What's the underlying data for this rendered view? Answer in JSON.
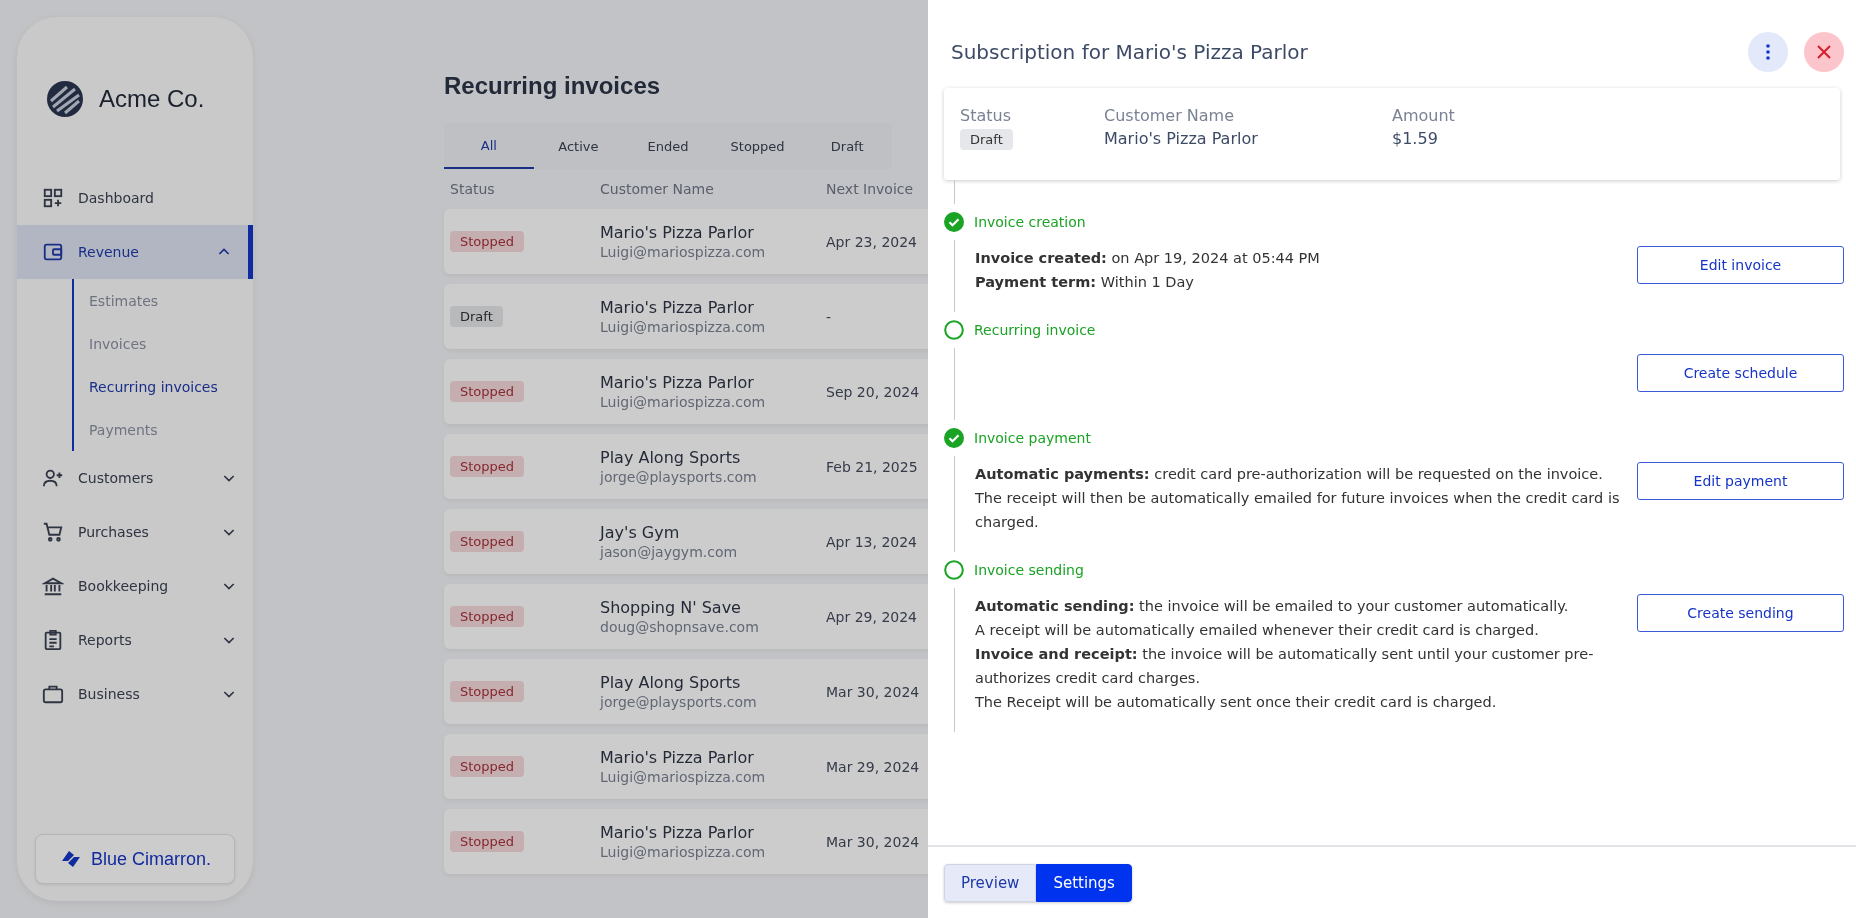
{
  "sidebar": {
    "brand": "Acme Co.",
    "items": [
      {
        "label": "Dashboard",
        "selected": false
      },
      {
        "label": "Revenue",
        "selected": true,
        "expanded": true,
        "children": [
          {
            "label": "Estimates",
            "selected": false
          },
          {
            "label": "Invoices",
            "selected": false
          },
          {
            "label": "Recurring invoices",
            "selected": true
          },
          {
            "label": "Payments",
            "selected": false
          }
        ]
      },
      {
        "label": "Customers",
        "selected": false,
        "expanded": false
      },
      {
        "label": "Purchases",
        "selected": false,
        "expanded": false
      },
      {
        "label": "Bookkeeping",
        "selected": false,
        "expanded": false
      },
      {
        "label": "Reports",
        "selected": false,
        "expanded": false
      },
      {
        "label": "Business",
        "selected": false,
        "expanded": false
      }
    ],
    "partner": "Blue Cimarron."
  },
  "page_title": "Recurring invoices",
  "tabs": [
    {
      "label": "All",
      "selected": true
    },
    {
      "label": "Active",
      "selected": false
    },
    {
      "label": "Ended",
      "selected": false
    },
    {
      "label": "Stopped",
      "selected": false
    },
    {
      "label": "Draft",
      "selected": false
    }
  ],
  "table": {
    "columns": [
      "Status",
      "Customer Name",
      "Next Invoice"
    ],
    "rows": [
      {
        "status": "Stopped",
        "kind": "stopped",
        "name": "Mario's Pizza Parlor",
        "email": "Luigi@mariospizza.com",
        "next": "Apr 23, 2024"
      },
      {
        "status": "Draft",
        "kind": "draft",
        "name": "Mario's Pizza Parlor",
        "email": "Luigi@mariospizza.com",
        "next": "-"
      },
      {
        "status": "Stopped",
        "kind": "stopped",
        "name": "Mario's Pizza Parlor",
        "email": "Luigi@mariospizza.com",
        "next": "Sep 20, 2024"
      },
      {
        "status": "Stopped",
        "kind": "stopped",
        "name": "Play Along Sports",
        "email": "jorge@playsports.com",
        "next": "Feb 21, 2025"
      },
      {
        "status": "Stopped",
        "kind": "stopped",
        "name": "Jay's Gym",
        "email": "jason@jaygym.com",
        "next": "Apr 13, 2024"
      },
      {
        "status": "Stopped",
        "kind": "stopped",
        "name": "Shopping N' Save",
        "email": "doug@shopnsave.com",
        "next": "Apr 29, 2024"
      },
      {
        "status": "Stopped",
        "kind": "stopped",
        "name": "Play Along Sports",
        "email": "jorge@playsports.com",
        "next": "Mar 30, 2024"
      },
      {
        "status": "Stopped",
        "kind": "stopped",
        "name": "Mario's Pizza Parlor",
        "email": "Luigi@mariospizza.com",
        "next": "Mar 29, 2024"
      },
      {
        "status": "Stopped",
        "kind": "stopped",
        "name": "Mario's Pizza Parlor",
        "email": "Luigi@mariospizza.com",
        "next": "Mar 30, 2024"
      }
    ]
  },
  "panel": {
    "title": "Subscription for Mario's Pizza Parlor",
    "summary": [
      {
        "label": "Status",
        "value": "Draft",
        "kind": "badge"
      },
      {
        "label": "Customer Name",
        "value": "Mario's Pizza Parlor",
        "kind": "text"
      },
      {
        "label": "Amount",
        "value": "$1.59",
        "kind": "text"
      }
    ],
    "steps": [
      {
        "title": "Invoice creation",
        "done": true,
        "lines": [
          "**Invoice created:** on Apr 19, 2024 at 05:44 PM",
          "**Payment term:** Within 1 Day"
        ],
        "button": "Edit invoice"
      },
      {
        "title": "Recurring invoice",
        "done": false,
        "button": "Create schedule"
      },
      {
        "title": "Invoice payment",
        "done": true,
        "lines": [
          "**Automatic payments:** credit card pre-authorization will be requested on the invoice. The receipt will then be automatically emailed for future invoices when the credit card is charged."
        ],
        "button": "Edit payment"
      },
      {
        "title": "Invoice sending",
        "done": false,
        "lines": [
          "**Automatic sending:** the invoice will be emailed to your customer automatically.",
          "A receipt will be automatically emailed whenever their credit card is charged.",
          "**Invoice and receipt:** the invoice will be automatically sent until your customer pre-authorizes credit card charges.",
          "The Receipt will be automatically sent once their credit card is charged."
        ],
        "button": "Create sending"
      }
    ],
    "view_toggle": [
      {
        "label": "Preview",
        "selected": false
      },
      {
        "label": "Settings",
        "selected": true
      }
    ]
  }
}
